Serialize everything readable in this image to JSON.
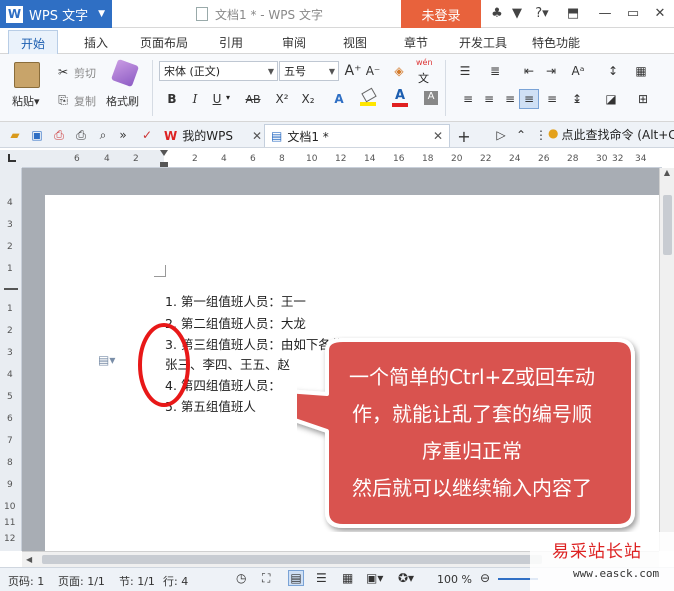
{
  "app": {
    "name": "WPS 文字",
    "window_title": "文档1 * - WPS 文字",
    "login_label": "未登录"
  },
  "menu": {
    "tabs": [
      "开始",
      "插入",
      "页面布局",
      "引用",
      "审阅",
      "视图",
      "章节",
      "开发工具",
      "特色功能"
    ]
  },
  "ribbon": {
    "paste_label": "粘贴",
    "cut_label": "剪切",
    "copy_label": "复制",
    "format_painter_label": "格式刷",
    "font_name": "宋体 (正文)",
    "font_size": "五号",
    "bold": "B",
    "italic": "I",
    "underline": "U",
    "strike": "AB",
    "superscript": "X²",
    "subscript": "X₂",
    "phonetic_top": "wén",
    "phonetic_bottom": "文",
    "font_color_letter": "A",
    "colors": {
      "highlight": "#ffe600",
      "font_color": "#e02020",
      "accent": "#2f6fc4"
    }
  },
  "doc_tabs": {
    "my_wps": "我的WPS",
    "doc1": "文档1 *",
    "find_command": "点此查找命令 (Alt+C"
  },
  "ruler": {
    "h_ticks": [
      "6",
      "4",
      "2",
      "2",
      "4",
      "6",
      "8",
      "10",
      "12",
      "14",
      "16",
      "18",
      "20",
      "22",
      "24",
      "26",
      "28",
      "30",
      "32",
      "34"
    ],
    "v_ticks": [
      "4",
      "3",
      "2",
      "1",
      "1",
      "2",
      "3",
      "4",
      "5",
      "6",
      "7",
      "8",
      "9",
      "10",
      "11",
      "12"
    ]
  },
  "document": {
    "lines": [
      "1. 第一组值班人员：王一",
      "2. 第二组值班人员：大龙",
      "3. 第三组值班人员：由如下各位同志组成",
      "张三、李四、王五、赵",
      "4. 第四组值班人员：",
      "5. 第五组值班人"
    ]
  },
  "callout": {
    "lines": [
      "一个简单的Ctrl+Z或回车动",
      "作，就能让乱了套的编号顺",
      "序重归正常",
      "然后就可以继续输入内容了"
    ],
    "colors": {
      "fill": "#d9534f",
      "border": "#ffffff",
      "circle": "#e81818"
    }
  },
  "status": {
    "page": "页码: 1",
    "pages": "页面: 1/1",
    "section": "节: 1/1",
    "row": "行: 4",
    "zoom": "100 %"
  },
  "watermark": {
    "text": "易采站长站",
    "url": "www.easck.com"
  }
}
